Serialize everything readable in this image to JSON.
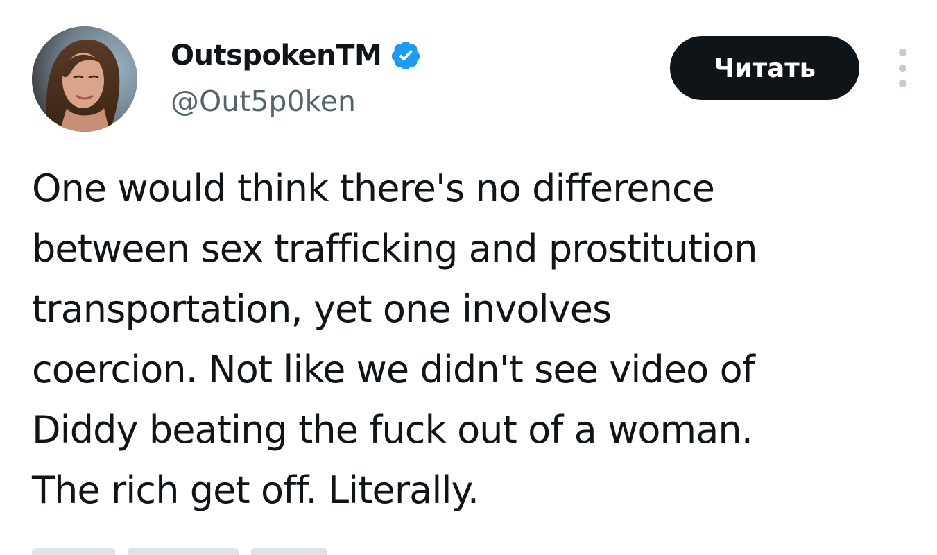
{
  "tweet": {
    "author": {
      "display_name": "OutspokenTM",
      "handle": "@Out5p0ken",
      "verified": true,
      "avatar_icon": "profile-photo"
    },
    "follow_button_label": "Читать",
    "more_icon": "more-vertical-icon",
    "text_lines": [
      "One would think there's no difference",
      "between sex trafficking and prostitution",
      "transportation, yet one involves",
      "coercion. Not like we didn't see video of",
      "Diddy beating the fuck out of a woman.",
      "The rich get off. Literally."
    ]
  },
  "colors": {
    "verified_badge": "#1d9bf0",
    "handle": "#536471",
    "button_bg": "#0f1419",
    "text": "#0f1419"
  }
}
